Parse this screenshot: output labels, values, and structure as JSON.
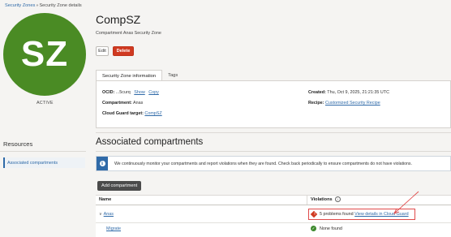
{
  "breadcrumb": {
    "root": "Security Zones",
    "separator": "»",
    "current": "Security Zone details"
  },
  "zone": {
    "avatar_initials": "SZ",
    "avatar_color": "#4a8b24",
    "status": "ACTIVE",
    "name": "CompSZ",
    "subtitle": "Compartment Anas Security Zone"
  },
  "actions": {
    "edit": "Edit",
    "delete": "Delete"
  },
  "tabs": [
    {
      "label": "Security Zone information",
      "active": true
    },
    {
      "label": "Tags",
      "active": false
    }
  ],
  "info": {
    "ocid_label": "OCID:",
    "ocid_value": "...5curq",
    "ocid_show": "Show",
    "ocid_copy": "Copy",
    "compartment_label": "Compartment:",
    "compartment_value": "Anas",
    "cloud_guard_label": "Cloud Guard target:",
    "cloud_guard_value": "CompSZ",
    "created_label": "Created:",
    "created_value": "Thu, Oct 9, 2025, 21:21:35 UTC",
    "recipe_label": "Recipe:",
    "recipe_value": "Customized Security Recipe"
  },
  "resources": {
    "title": "Resources",
    "items": [
      {
        "label": "Associated compartments",
        "active": true
      }
    ]
  },
  "section": {
    "title": "Associated compartments",
    "notice_icon": "info-icon",
    "notice": "We continuously monitor your compartments and report violations when they are found. Check back periodically to ensure compartments do not have violations.",
    "add_button": "Add compartment"
  },
  "table": {
    "columns": [
      "Name",
      "Violations"
    ],
    "rows": [
      {
        "name": "Anas",
        "violation_text": "5 problems found",
        "violation_link": "View details in Cloud Guard",
        "status": "error"
      },
      {
        "name": "Migrate",
        "violation_text": "None found",
        "violation_link": "",
        "status": "ok"
      }
    ]
  },
  "colors": {
    "accent": "#2f6aa8",
    "danger": "#d03a21",
    "success": "#3e8a2e"
  }
}
